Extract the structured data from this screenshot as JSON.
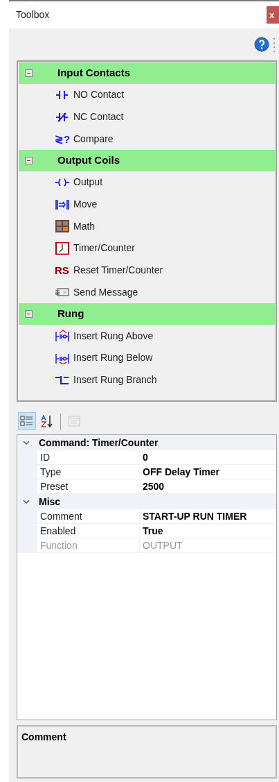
{
  "window": {
    "title": "Toolbox",
    "close": "x"
  },
  "toolbox": {
    "groups": [
      {
        "label": "Input Contacts",
        "expanded": true,
        "items": [
          {
            "label": "NO Contact",
            "kind": "no-contact"
          },
          {
            "label": "NC Contact",
            "kind": "nc-contact"
          },
          {
            "label": "Compare",
            "kind": "compare",
            "icon_text": "≷?"
          }
        ]
      },
      {
        "label": "Output Coils",
        "expanded": true,
        "items": [
          {
            "label": "Output",
            "kind": "output"
          },
          {
            "label": "Move",
            "kind": "move"
          },
          {
            "label": "Math",
            "kind": "math"
          },
          {
            "label": "Timer/Counter",
            "kind": "timer"
          },
          {
            "label": "Reset Timer/Counter",
            "kind": "reset",
            "icon_text": "RS"
          },
          {
            "label": "Send Message",
            "kind": "message"
          }
        ]
      },
      {
        "label": "Rung",
        "expanded": true,
        "items": [
          {
            "label": "Insert Rung Above",
            "kind": "rung-above"
          },
          {
            "label": "Insert Rung Below",
            "kind": "rung-below"
          },
          {
            "label": "Insert Rung Branch",
            "kind": "rung-branch"
          }
        ]
      }
    ]
  },
  "property_toolbar": [
    {
      "kind": "categorized",
      "selected": true,
      "disabled": false
    },
    {
      "kind": "alphabetical",
      "selected": false,
      "disabled": false
    },
    {
      "kind": "property-pages",
      "selected": false,
      "disabled": true
    }
  ],
  "properties": {
    "categories": [
      {
        "label": "Command: Timer/Counter",
        "expanded": true,
        "rows": [
          {
            "name": "ID",
            "value": "0",
            "disabled": false
          },
          {
            "name": "Type",
            "value": "OFF Delay Timer",
            "disabled": false
          },
          {
            "name": "Preset",
            "value": "2500",
            "disabled": false
          }
        ]
      },
      {
        "label": "Misc",
        "expanded": true,
        "rows": [
          {
            "name": "Comment",
            "value": "START-UP RUN TIMER",
            "disabled": false
          },
          {
            "name": "Enabled",
            "value": "True",
            "disabled": false
          },
          {
            "name": "Function",
            "value": "OUTPUT",
            "disabled": true
          }
        ]
      }
    ]
  },
  "description": {
    "title": "Comment"
  }
}
